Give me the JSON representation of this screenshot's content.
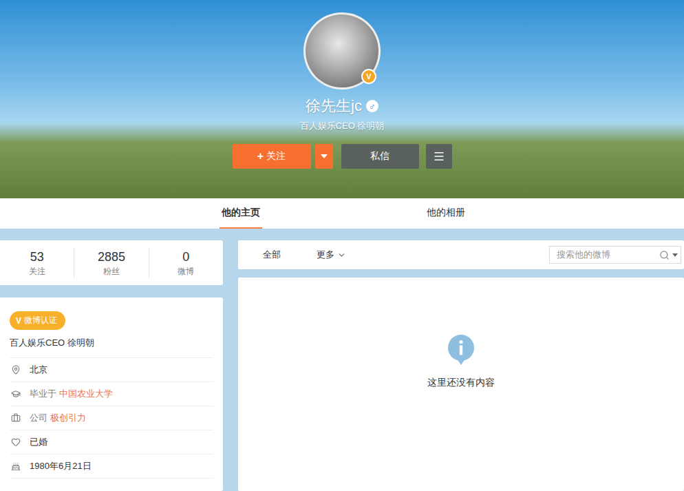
{
  "profile": {
    "name": "徐先生jc",
    "gender_mark": "♂",
    "verified_mark": "V",
    "subtitle": "百人娱乐CEO 徐明朝"
  },
  "actions": {
    "follow": {
      "icon": "+",
      "label": "关注"
    },
    "message": "私信"
  },
  "tabs": [
    {
      "label": "他的主页",
      "selected": true
    },
    {
      "label": "他的相册",
      "selected": false
    }
  ],
  "stats": [
    {
      "value": "53",
      "label": "关注"
    },
    {
      "value": "2885",
      "label": "粉丝"
    },
    {
      "value": "0",
      "label": "微博"
    }
  ],
  "info": {
    "badge": {
      "icon": "V",
      "label": "微博认证"
    },
    "title": "百人娱乐CEO 徐明朝",
    "rows": [
      {
        "kind": "location",
        "prefix": "",
        "text": "北京",
        "link": ""
      },
      {
        "kind": "school",
        "prefix": "毕业于",
        "text": "",
        "link": "中国农业大学"
      },
      {
        "kind": "company",
        "prefix": "公司",
        "text": "",
        "link": "极创引力"
      },
      {
        "kind": "relationship",
        "prefix": "",
        "text": "已婚",
        "link": ""
      },
      {
        "kind": "birthday",
        "prefix": "",
        "text": "1980年6月21日",
        "link": ""
      }
    ]
  },
  "feed": {
    "filters": [
      {
        "label": "全部",
        "dropdown": false
      },
      {
        "label": "更多",
        "dropdown": true
      }
    ],
    "search_placeholder": "搜索他的微博",
    "empty": "这里还没有内容"
  }
}
